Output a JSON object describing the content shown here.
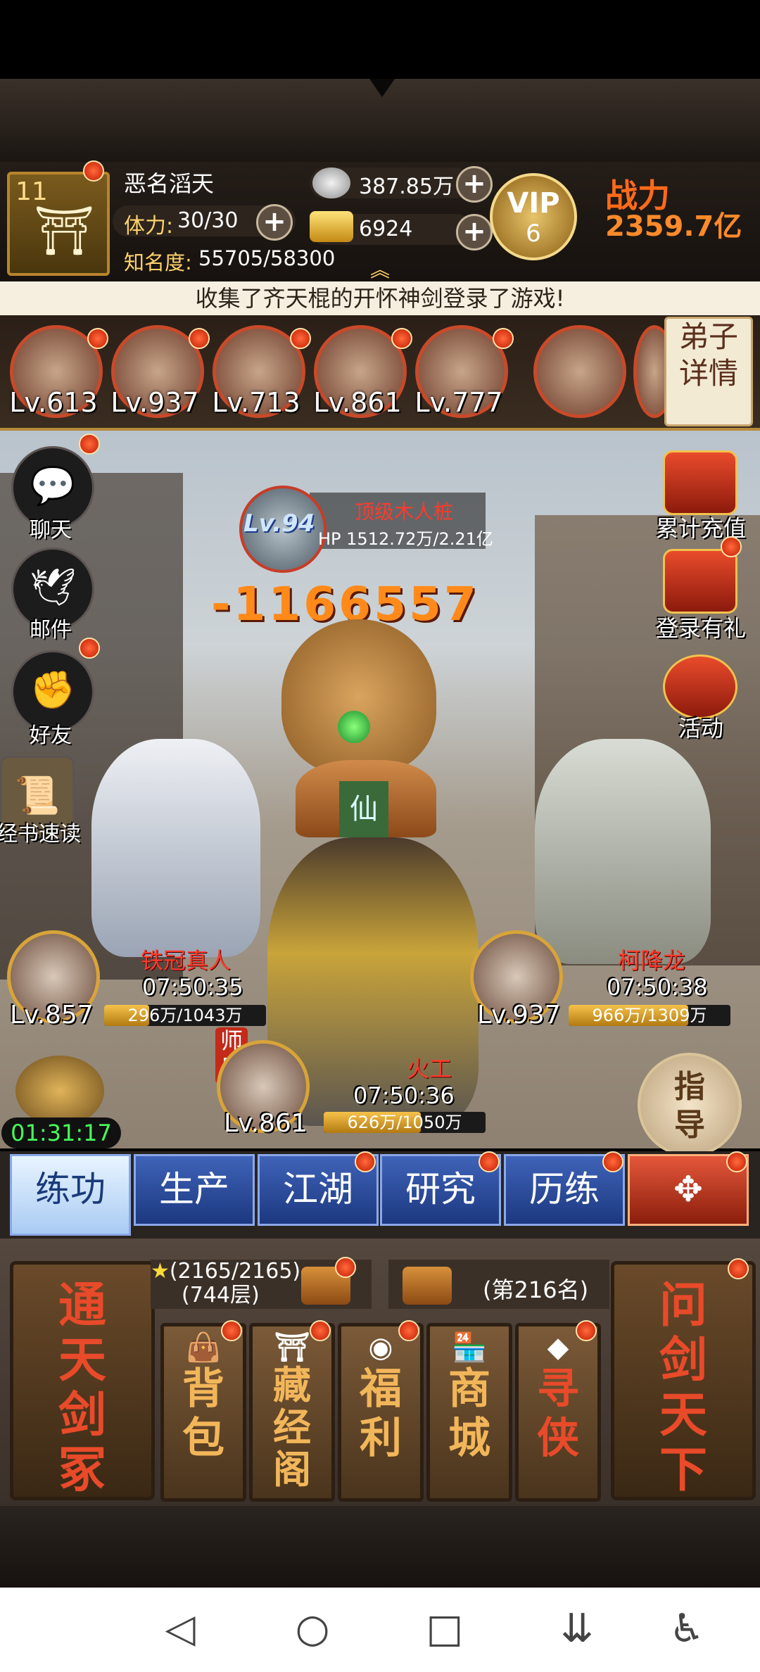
{
  "player": {
    "level": "11",
    "name": "恶名滔天",
    "stamina_label": "体力:",
    "stamina_value": "30/30",
    "fame_label": "知名度:",
    "fame_value": "55705/58300",
    "silver": "387.85万",
    "gold": "6924",
    "vip_label": "VIP",
    "vip_level": "6",
    "power_label": "战力",
    "power_value": "2359.7亿"
  },
  "announcement": "收集了齐天棍的开怀神剑登录了游戏!",
  "disciples": [
    {
      "level": "Lv.613"
    },
    {
      "level": "Lv.937"
    },
    {
      "level": "Lv.713"
    },
    {
      "level": "Lv.861"
    },
    {
      "level": "Lv.777"
    }
  ],
  "disciple_detail_label": "弟子详情",
  "left_menu": [
    {
      "label": "聊天",
      "icon": "chat-bubble-icon"
    },
    {
      "label": "邮件",
      "icon": "dove-icon"
    },
    {
      "label": "好友",
      "icon": "fist-icon"
    },
    {
      "label": "经书速读",
      "icon": "scroll-book-icon"
    }
  ],
  "right_menu": [
    {
      "label": "累计充值",
      "icon": "treasure-icon"
    },
    {
      "label": "登录有礼",
      "icon": "chest-icon"
    },
    {
      "label": "活动",
      "icon": "lantern-icon"
    }
  ],
  "boss": {
    "level": "Lv.94",
    "name": "顶级木人桩",
    "hp": "HP 1512.72万/2.21亿"
  },
  "damage": "-1166557",
  "fighters": [
    {
      "name": "铁冠真人",
      "level": "Lv.857",
      "time": "07:50:35",
      "hp": "296万/1043万",
      "hp_fraction": 0.28
    },
    {
      "name": "柯降龙",
      "level": "Lv.937",
      "time": "07:50:38",
      "hp": "966万/1309万",
      "hp_fraction": 0.74
    },
    {
      "name": "火工",
      "level": "Lv.861",
      "time": "07:50:36",
      "hp": "626万/1050万",
      "hp_fraction": 0.6,
      "tag": "师兄"
    }
  ],
  "chest_timer": "01:31:17",
  "guide_label": "指导",
  "tabs": [
    "练功",
    "生产",
    "江湖",
    "研究",
    "历练"
  ],
  "bottom": {
    "left_card": "通天剑冢",
    "right_card": "问剑天下",
    "star_progress": "(2165/2165)",
    "floor": "(744层)",
    "rank": "(第216名)",
    "cards": [
      {
        "label": "背包",
        "icon": "bag-icon"
      },
      {
        "label": "藏经阁",
        "icon": "pavilion-icon"
      },
      {
        "label": "福利",
        "icon": "coin-icon"
      },
      {
        "label": "商城",
        "icon": "shop-icon"
      },
      {
        "label": "寻侠",
        "icon": "seek-icon"
      }
    ]
  },
  "colors": {
    "accent_red": "#c84a2a",
    "tab_blue": "#1c3880",
    "gold": "#d8a43a",
    "timer_green": "#46ff5a"
  }
}
